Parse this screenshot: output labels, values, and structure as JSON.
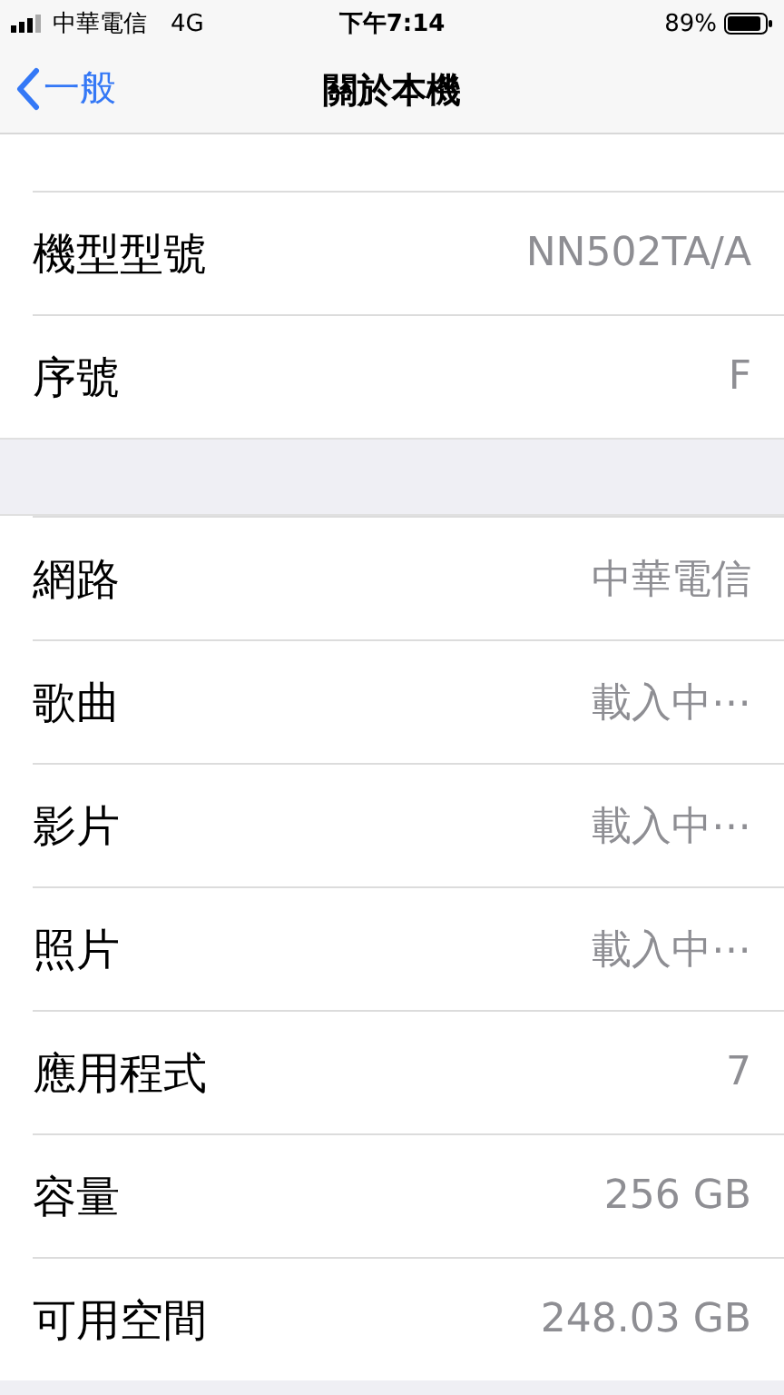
{
  "status_bar": {
    "carrier": "中華電信",
    "network": "4G",
    "time": "下午7:14",
    "battery": "89%"
  },
  "nav": {
    "back": "一般",
    "title": "關於本機"
  },
  "sections": [
    {
      "rows": [
        {
          "label": "機型型號",
          "value": "NN502TA/A"
        },
        {
          "label": "序號",
          "value": "F"
        }
      ]
    },
    {
      "rows": [
        {
          "label": "網路",
          "value": "中華電信"
        },
        {
          "label": "歌曲",
          "value": "載入中⋯"
        },
        {
          "label": "影片",
          "value": "載入中⋯"
        },
        {
          "label": "照片",
          "value": "載入中⋯"
        },
        {
          "label": "應用程式",
          "value": "7"
        },
        {
          "label": "容量",
          "value": "256 GB"
        },
        {
          "label": "可用空間",
          "value": "248.03 GB"
        }
      ]
    }
  ]
}
